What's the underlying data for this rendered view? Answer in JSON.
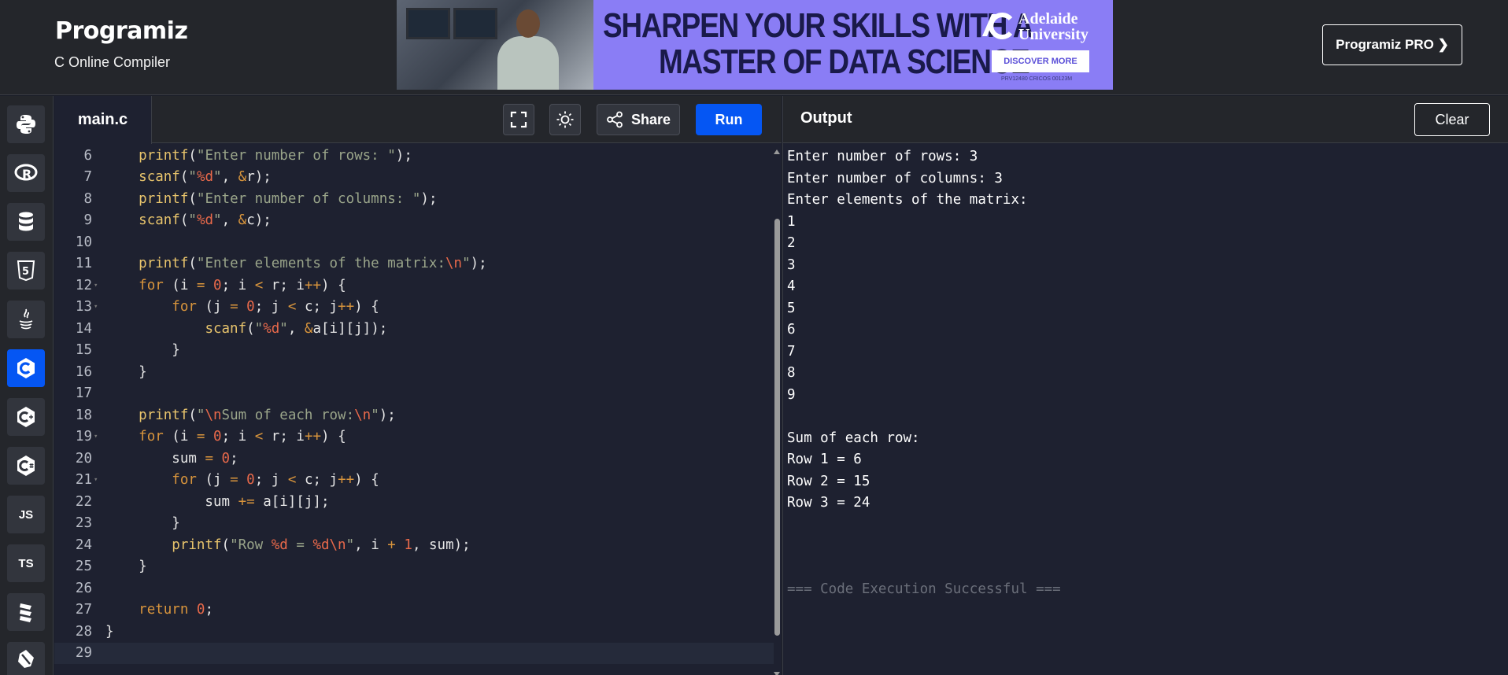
{
  "header": {
    "logo": "Programiz",
    "subtitle": "C Online Compiler",
    "pro_button": "Programiz PRO ❯"
  },
  "ad": {
    "headline_1": "SHARPEN YOUR SKILLS WITH A",
    "headline_2": "MASTER OF DATA SCIENCE",
    "university": "Adelaide\nUniversity",
    "cta": "DISCOVER MORE",
    "fine_print": "PRV12480 CRICOS 00123M",
    "colors": {
      "background": "#8a7df5",
      "text": "#1a1a4a"
    }
  },
  "sidebar": {
    "languages": [
      {
        "name": "python-icon",
        "glyph": ""
      },
      {
        "name": "r-icon",
        "glyph": "R"
      },
      {
        "name": "sql-icon",
        "glyph": ""
      },
      {
        "name": "html-icon",
        "glyph": "5"
      },
      {
        "name": "java-icon",
        "glyph": ""
      },
      {
        "name": "c-icon",
        "glyph": "C",
        "active": true
      },
      {
        "name": "cpp-icon",
        "glyph": "C+"
      },
      {
        "name": "csharp-icon",
        "glyph": "C#"
      },
      {
        "name": "javascript-icon",
        "glyph": "JS"
      },
      {
        "name": "typescript-icon",
        "glyph": "TS"
      },
      {
        "name": "swift-icon",
        "glyph": ""
      },
      {
        "name": "go-icon",
        "glyph": ""
      }
    ]
  },
  "editor": {
    "tab": "main.c",
    "share_label": "Share",
    "run_label": "Run",
    "lines": [
      {
        "n": "6",
        "fold": "",
        "code": [
          [
            "    ",
            ""
          ],
          [
            "printf",
            "fn"
          ],
          [
            "(",
            ""
          ],
          [
            "\"Enter number of rows: \"",
            "str"
          ],
          [
            ");",
            ""
          ]
        ]
      },
      {
        "n": "7",
        "fold": "",
        "code": [
          [
            "    ",
            ""
          ],
          [
            "scanf",
            "fn"
          ],
          [
            "(",
            ""
          ],
          [
            "\"",
            "str"
          ],
          [
            "%d",
            "fmt"
          ],
          [
            "\"",
            "str"
          ],
          [
            ", ",
            ""
          ],
          [
            "&",
            "op"
          ],
          [
            "r);",
            ""
          ]
        ]
      },
      {
        "n": "8",
        "fold": "",
        "code": [
          [
            "    ",
            ""
          ],
          [
            "printf",
            "fn"
          ],
          [
            "(",
            ""
          ],
          [
            "\"Enter number of columns: \"",
            "str"
          ],
          [
            ");",
            ""
          ]
        ]
      },
      {
        "n": "9",
        "fold": "",
        "code": [
          [
            "    ",
            ""
          ],
          [
            "scanf",
            "fn"
          ],
          [
            "(",
            ""
          ],
          [
            "\"",
            "str"
          ],
          [
            "%d",
            "fmt"
          ],
          [
            "\"",
            "str"
          ],
          [
            ", ",
            ""
          ],
          [
            "&",
            "op"
          ],
          [
            "c);",
            ""
          ]
        ]
      },
      {
        "n": "10",
        "fold": "",
        "code": []
      },
      {
        "n": "11",
        "fold": "",
        "code": [
          [
            "    ",
            ""
          ],
          [
            "printf",
            "fn"
          ],
          [
            "(",
            ""
          ],
          [
            "\"Enter elements of the matrix:",
            "str"
          ],
          [
            "\\n",
            "fmt"
          ],
          [
            "\"",
            "str"
          ],
          [
            ");",
            ""
          ]
        ]
      },
      {
        "n": "12",
        "fold": "▾",
        "code": [
          [
            "    ",
            ""
          ],
          [
            "for",
            "kw"
          ],
          [
            " (i ",
            ""
          ],
          [
            "=",
            "op"
          ],
          [
            " ",
            ""
          ],
          [
            "0",
            "num"
          ],
          [
            "; i ",
            ""
          ],
          [
            "<",
            "op"
          ],
          [
            " r; i",
            ""
          ],
          [
            "++",
            "op"
          ],
          [
            ") {",
            ""
          ]
        ]
      },
      {
        "n": "13",
        "fold": "▾",
        "code": [
          [
            "        ",
            ""
          ],
          [
            "for",
            "kw"
          ],
          [
            " (j ",
            ""
          ],
          [
            "=",
            "op"
          ],
          [
            " ",
            ""
          ],
          [
            "0",
            "num"
          ],
          [
            "; j ",
            ""
          ],
          [
            "<",
            "op"
          ],
          [
            " c; j",
            ""
          ],
          [
            "++",
            "op"
          ],
          [
            ") {",
            ""
          ]
        ]
      },
      {
        "n": "14",
        "fold": "",
        "code": [
          [
            "            ",
            ""
          ],
          [
            "scanf",
            "fn"
          ],
          [
            "(",
            ""
          ],
          [
            "\"",
            "str"
          ],
          [
            "%d",
            "fmt"
          ],
          [
            "\"",
            "str"
          ],
          [
            ", ",
            ""
          ],
          [
            "&",
            "op"
          ],
          [
            "a[i][j]);",
            ""
          ]
        ]
      },
      {
        "n": "15",
        "fold": "",
        "code": [
          [
            "        }",
            ""
          ]
        ]
      },
      {
        "n": "16",
        "fold": "",
        "code": [
          [
            "    }",
            ""
          ]
        ]
      },
      {
        "n": "17",
        "fold": "",
        "code": []
      },
      {
        "n": "18",
        "fold": "",
        "code": [
          [
            "    ",
            ""
          ],
          [
            "printf",
            "fn"
          ],
          [
            "(",
            ""
          ],
          [
            "\"",
            "str"
          ],
          [
            "\\n",
            "fmt"
          ],
          [
            "Sum of each row:",
            "str"
          ],
          [
            "\\n",
            "fmt"
          ],
          [
            "\"",
            "str"
          ],
          [
            ");",
            ""
          ]
        ]
      },
      {
        "n": "19",
        "fold": "▾",
        "code": [
          [
            "    ",
            ""
          ],
          [
            "for",
            "kw"
          ],
          [
            " (i ",
            ""
          ],
          [
            "=",
            "op"
          ],
          [
            " ",
            ""
          ],
          [
            "0",
            "num"
          ],
          [
            "; i ",
            ""
          ],
          [
            "<",
            "op"
          ],
          [
            " r; i",
            ""
          ],
          [
            "++",
            "op"
          ],
          [
            ") {",
            ""
          ]
        ]
      },
      {
        "n": "20",
        "fold": "",
        "code": [
          [
            "        sum ",
            ""
          ],
          [
            "=",
            "op"
          ],
          [
            " ",
            ""
          ],
          [
            "0",
            "num"
          ],
          [
            ";",
            ""
          ]
        ]
      },
      {
        "n": "21",
        "fold": "▾",
        "code": [
          [
            "        ",
            ""
          ],
          [
            "for",
            "kw"
          ],
          [
            " (j ",
            ""
          ],
          [
            "=",
            "op"
          ],
          [
            " ",
            ""
          ],
          [
            "0",
            "num"
          ],
          [
            "; j ",
            ""
          ],
          [
            "<",
            "op"
          ],
          [
            " c; j",
            ""
          ],
          [
            "++",
            "op"
          ],
          [
            ") {",
            ""
          ]
        ]
      },
      {
        "n": "22",
        "fold": "",
        "code": [
          [
            "            sum ",
            ""
          ],
          [
            "+=",
            "op"
          ],
          [
            " a[i][j];",
            ""
          ]
        ]
      },
      {
        "n": "23",
        "fold": "",
        "code": [
          [
            "        }",
            ""
          ]
        ]
      },
      {
        "n": "24",
        "fold": "",
        "code": [
          [
            "        ",
            ""
          ],
          [
            "printf",
            "fn"
          ],
          [
            "(",
            ""
          ],
          [
            "\"Row ",
            "str"
          ],
          [
            "%d",
            "fmt"
          ],
          [
            " = ",
            "str"
          ],
          [
            "%d",
            "fmt"
          ],
          [
            "\\n",
            "fmt"
          ],
          [
            "\"",
            "str"
          ],
          [
            ", i ",
            ""
          ],
          [
            "+",
            "op"
          ],
          [
            " ",
            ""
          ],
          [
            "1",
            "num"
          ],
          [
            ", sum);",
            ""
          ]
        ]
      },
      {
        "n": "25",
        "fold": "",
        "code": [
          [
            "    }",
            ""
          ]
        ]
      },
      {
        "n": "26",
        "fold": "",
        "code": []
      },
      {
        "n": "27",
        "fold": "",
        "code": [
          [
            "    ",
            ""
          ],
          [
            "return",
            "kw"
          ],
          [
            " ",
            ""
          ],
          [
            "0",
            "num"
          ],
          [
            ";",
            ""
          ]
        ]
      },
      {
        "n": "28",
        "fold": "",
        "code": [
          [
            "}",
            ""
          ]
        ]
      },
      {
        "n": "29",
        "fold": "",
        "code": [],
        "current": true
      }
    ],
    "colors": {
      "fn": "#e8c46c",
      "str": "#9aa58a",
      "fmt": "#e8694a",
      "kw": "#d9953c",
      "num": "#e8694a",
      "op": "#d9953c"
    }
  },
  "output": {
    "title": "Output",
    "clear_label": "Clear",
    "lines": [
      "Enter number of rows: 3",
      "Enter number of columns: 3",
      "Enter elements of the matrix:",
      "1",
      "2",
      "3",
      "4",
      "5",
      "6",
      "7",
      "8",
      "9",
      "",
      "Sum of each row:",
      "Row 1 = 6",
      "Row 2 = 15",
      "Row 3 = 24",
      "",
      "",
      ""
    ],
    "status": "=== Code Execution Successful ==="
  }
}
